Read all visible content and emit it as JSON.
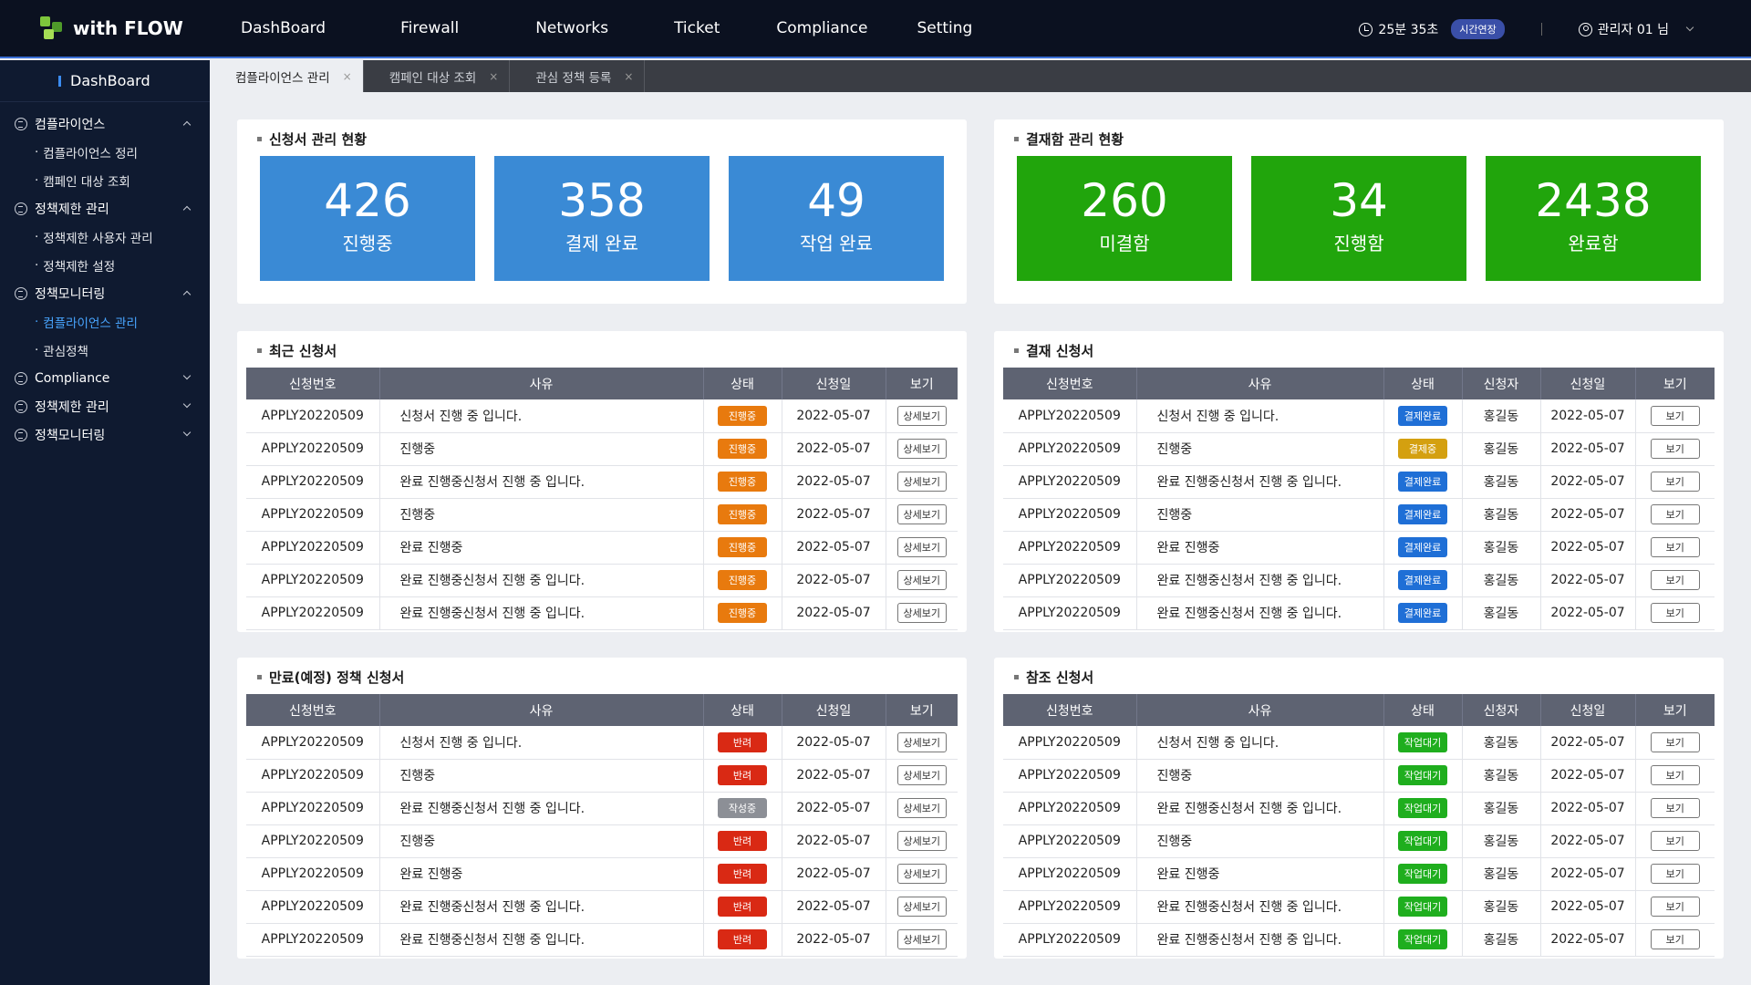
{
  "brand": {
    "name": "with FLOW"
  },
  "nav": [
    "DashBoard",
    "Firewall",
    "Networks",
    "Ticket",
    "Compliance",
    "Setting"
  ],
  "session": {
    "remaining": "25분 35초",
    "extend_label": "시간연장",
    "user": "관리자 01 님"
  },
  "sidebar": {
    "title": "DashBoard",
    "items": [
      {
        "label": "컴플라이언스",
        "type": "group",
        "open": true
      },
      {
        "label": "컴플라이언스 정리",
        "type": "sub"
      },
      {
        "label": "캠페인 대상 조회",
        "type": "sub"
      },
      {
        "label": "정책제한 관리",
        "type": "group",
        "open": true
      },
      {
        "label": "정책제한 사용자 관리",
        "type": "sub"
      },
      {
        "label": "정책제한 설정",
        "type": "sub"
      },
      {
        "label": "정책모니터링",
        "type": "group",
        "open": true
      },
      {
        "label": "컴플라이언스 관리",
        "type": "sub",
        "active": true
      },
      {
        "label": "관심정책",
        "type": "sub"
      },
      {
        "label": "Compliance",
        "type": "group",
        "open": false
      },
      {
        "label": "정책제한 관리",
        "type": "group",
        "open": false
      },
      {
        "label": "정책모니터링",
        "type": "group",
        "open": false
      }
    ]
  },
  "tabs": [
    {
      "label": "컴플라이언스 관리",
      "active": true
    },
    {
      "label": "캠페인 대상 조회",
      "active": false
    },
    {
      "label": "관심 정책 등록",
      "active": false
    }
  ],
  "summary1": {
    "title": "신청서 관리 현황",
    "cards": [
      {
        "value": "426",
        "label": "진행중"
      },
      {
        "value": "358",
        "label": "결제 완료"
      },
      {
        "value": "49",
        "label": "작업 완료"
      }
    ]
  },
  "summary2": {
    "title": "결재함 관리 현황",
    "cards": [
      {
        "value": "260",
        "label": "미결함"
      },
      {
        "value": "34",
        "label": "진행함"
      },
      {
        "value": "2438",
        "label": "완료함"
      }
    ]
  },
  "table1": {
    "title": "최근 신청서",
    "headers": [
      "신청번호",
      "사유",
      "상태",
      "신청일",
      "보기"
    ],
    "button_label": "상세보기",
    "rows": [
      {
        "id": "APPLY20220509",
        "reason": "신청서 진행 중 입니다.",
        "status": "진행중",
        "status_color": "#e87a0e",
        "date": "2022-05-07"
      },
      {
        "id": "APPLY20220509",
        "reason": "진행중",
        "status": "진행중",
        "status_color": "#e87a0e",
        "date": "2022-05-07"
      },
      {
        "id": "APPLY20220509",
        "reason": "완료 진행중신청서 진행 중 입니다.",
        "status": "진행중",
        "status_color": "#e87a0e",
        "date": "2022-05-07"
      },
      {
        "id": "APPLY20220509",
        "reason": "진행중",
        "status": "진행중",
        "status_color": "#e87a0e",
        "date": "2022-05-07"
      },
      {
        "id": "APPLY20220509",
        "reason": "완료 진행중",
        "status": "진행중",
        "status_color": "#e87a0e",
        "date": "2022-05-07"
      },
      {
        "id": "APPLY20220509",
        "reason": "완료 진행중신청서 진행 중 입니다.",
        "status": "진행중",
        "status_color": "#e87a0e",
        "date": "2022-05-07"
      },
      {
        "id": "APPLY20220509",
        "reason": "완료 진행중신청서 진행 중 입니다.",
        "status": "진행중",
        "status_color": "#e87a0e",
        "date": "2022-05-07"
      }
    ]
  },
  "table2": {
    "title": "결재 신청서",
    "headers": [
      "신청번호",
      "사유",
      "상태",
      "신청자",
      "신청일",
      "보기"
    ],
    "button_label": "보기",
    "rows": [
      {
        "id": "APPLY20220509",
        "reason": "신청서 진행 중 입니다.",
        "status": "결제완료",
        "status_color": "#1f6fd6",
        "requester": "홍길동",
        "date": "2022-05-07"
      },
      {
        "id": "APPLY20220509",
        "reason": "진행중",
        "status": "결제중",
        "status_color": "#d4a010",
        "requester": "홍길동",
        "date": "2022-05-07"
      },
      {
        "id": "APPLY20220509",
        "reason": "완료 진행중신청서 진행 중 입니다.",
        "status": "결제완료",
        "status_color": "#1f6fd6",
        "requester": "홍길동",
        "date": "2022-05-07"
      },
      {
        "id": "APPLY20220509",
        "reason": "진행중",
        "status": "결제완료",
        "status_color": "#1f6fd6",
        "requester": "홍길동",
        "date": "2022-05-07"
      },
      {
        "id": "APPLY20220509",
        "reason": "완료 진행중",
        "status": "결제완료",
        "status_color": "#1f6fd6",
        "requester": "홍길동",
        "date": "2022-05-07"
      },
      {
        "id": "APPLY20220509",
        "reason": "완료 진행중신청서 진행 중 입니다.",
        "status": "결제완료",
        "status_color": "#1f6fd6",
        "requester": "홍길동",
        "date": "2022-05-07"
      },
      {
        "id": "APPLY20220509",
        "reason": "완료 진행중신청서 진행 중 입니다.",
        "status": "결제완료",
        "status_color": "#1f6fd6",
        "requester": "홍길동",
        "date": "2022-05-07"
      }
    ]
  },
  "table3": {
    "title": "만료(예정) 정책 신청서",
    "headers": [
      "신청번호",
      "사유",
      "상태",
      "신청일",
      "보기"
    ],
    "button_label": "상세보기",
    "rows": [
      {
        "id": "APPLY20220509",
        "reason": "신청서 진행 중 입니다.",
        "status": "반려",
        "status_color": "#d92914",
        "date": "2022-05-07"
      },
      {
        "id": "APPLY20220509",
        "reason": "진행중",
        "status": "반려",
        "status_color": "#d92914",
        "date": "2022-05-07"
      },
      {
        "id": "APPLY20220509",
        "reason": "완료 진행중신청서 진행 중 입니다.",
        "status": "작성중",
        "status_color": "#8c8f96",
        "date": "2022-05-07"
      },
      {
        "id": "APPLY20220509",
        "reason": "진행중",
        "status": "반려",
        "status_color": "#d92914",
        "date": "2022-05-07"
      },
      {
        "id": "APPLY20220509",
        "reason": "완료 진행중",
        "status": "반려",
        "status_color": "#d92914",
        "date": "2022-05-07"
      },
      {
        "id": "APPLY20220509",
        "reason": "완료 진행중신청서 진행 중 입니다.",
        "status": "반려",
        "status_color": "#d92914",
        "date": "2022-05-07"
      },
      {
        "id": "APPLY20220509",
        "reason": "완료 진행중신청서 진행 중 입니다.",
        "status": "반려",
        "status_color": "#d92914",
        "date": "2022-05-07"
      }
    ]
  },
  "table4": {
    "title": "참조 신청서",
    "headers": [
      "신청번호",
      "사유",
      "상태",
      "신청자",
      "신청일",
      "보기"
    ],
    "button_label": "보기",
    "rows": [
      {
        "id": "APPLY20220509",
        "reason": "신청서 진행 중 입니다.",
        "status": "작업대기",
        "status_color": "#1fae1e",
        "requester": "홍길동",
        "date": "2022-05-07"
      },
      {
        "id": "APPLY20220509",
        "reason": "진행중",
        "status": "작업대기",
        "status_color": "#1fae1e",
        "requester": "홍길동",
        "date": "2022-05-07"
      },
      {
        "id": "APPLY20220509",
        "reason": "완료 진행중신청서 진행 중 입니다.",
        "status": "작업대기",
        "status_color": "#1fae1e",
        "requester": "홍길동",
        "date": "2022-05-07"
      },
      {
        "id": "APPLY20220509",
        "reason": "진행중",
        "status": "작업대기",
        "status_color": "#1fae1e",
        "requester": "홍길동",
        "date": "2022-05-07"
      },
      {
        "id": "APPLY20220509",
        "reason": "완료 진행중",
        "status": "작업대기",
        "status_color": "#1fae1e",
        "requester": "홍길동",
        "date": "2022-05-07"
      },
      {
        "id": "APPLY20220509",
        "reason": "완료 진행중신청서 진행 중 입니다.",
        "status": "작업대기",
        "status_color": "#1fae1e",
        "requester": "홍길동",
        "date": "2022-05-07"
      },
      {
        "id": "APPLY20220509",
        "reason": "완료 진행중신청서 진행 중 입니다.",
        "status": "작업대기",
        "status_color": "#1fae1e",
        "requester": "홍길동",
        "date": "2022-05-07"
      }
    ]
  }
}
